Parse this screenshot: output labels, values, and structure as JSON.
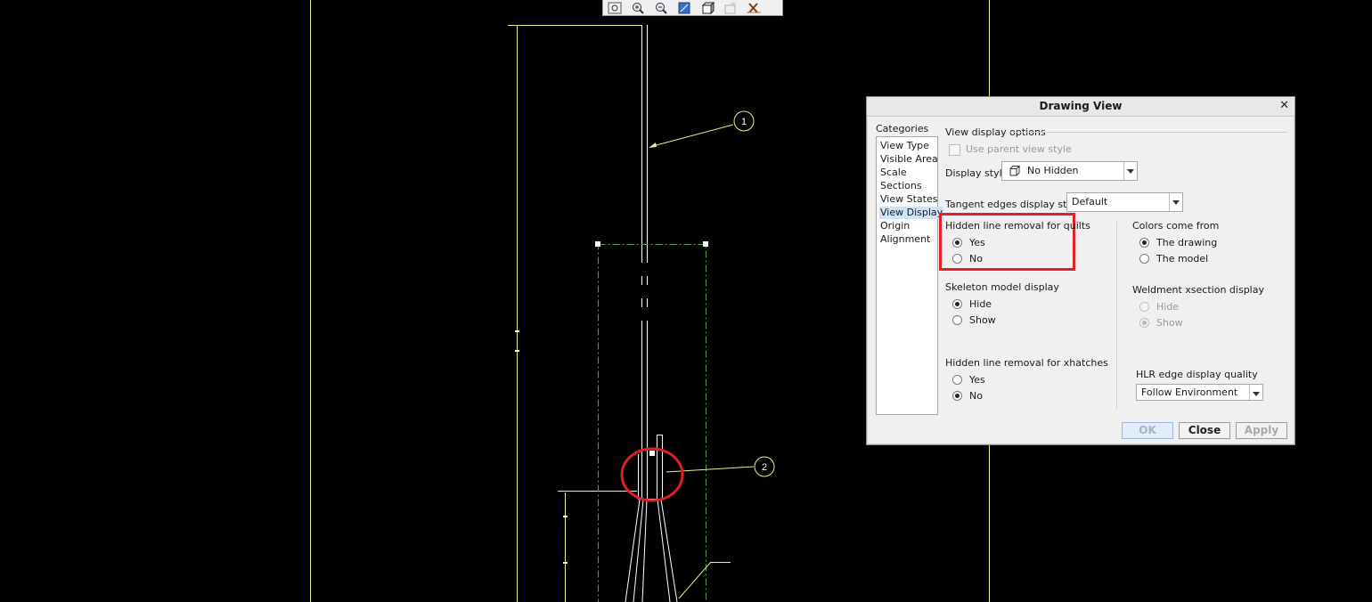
{
  "toolbar": {
    "icons": [
      "zoom-fit-icon",
      "zoom-in-icon",
      "zoom-out-icon",
      "repaint-icon",
      "shaded-view-icon",
      "annotation-icon",
      "delete-icon"
    ]
  },
  "drawing": {
    "balloon_1": "1",
    "balloon_2": "2"
  },
  "dialog": {
    "title": "Drawing View",
    "categories_label": "Categories",
    "categories": [
      "View Type",
      "Visible Area",
      "Scale",
      "Sections",
      "View States",
      "View Display",
      "Origin",
      "Alignment"
    ],
    "selected_category": "View Display",
    "section_title": "View display options",
    "use_parent_view_style": "Use parent view style",
    "display_style_label": "Display style",
    "display_style_value": "No Hidden",
    "tangent_edges_label": "Tangent edges display style",
    "tangent_edges_value": "Default",
    "hlr_quilts_label": "Hidden line removal for quilts",
    "hlr_quilts_yes": "Yes",
    "hlr_quilts_no": "No",
    "hlr_quilts_selected": "Yes",
    "skeleton_label": "Skeleton model display",
    "skeleton_hide": "Hide",
    "skeleton_show": "Show",
    "skeleton_selected": "Hide",
    "hlr_xhatches_label": "Hidden line removal for xhatches",
    "hlr_xhatches_yes": "Yes",
    "hlr_xhatches_no": "No",
    "hlr_xhatches_selected": "No",
    "colors_label": "Colors come from",
    "colors_drawing": "The drawing",
    "colors_model": "The model",
    "colors_selected": "The drawing",
    "weldment_label": "Weldment xsection display",
    "weldment_hide": "Hide",
    "weldment_show": "Show",
    "weldment_selected": "Show",
    "hlr_quality_label": "HLR edge display quality",
    "hlr_quality_value": "Follow Environment",
    "ok": "OK",
    "close": "Close",
    "apply": "Apply"
  },
  "colors": {
    "background": "#000000",
    "border_lines": "#e8f28c",
    "drawing_lines": "#ffffff",
    "highlight": "#e02028"
  }
}
